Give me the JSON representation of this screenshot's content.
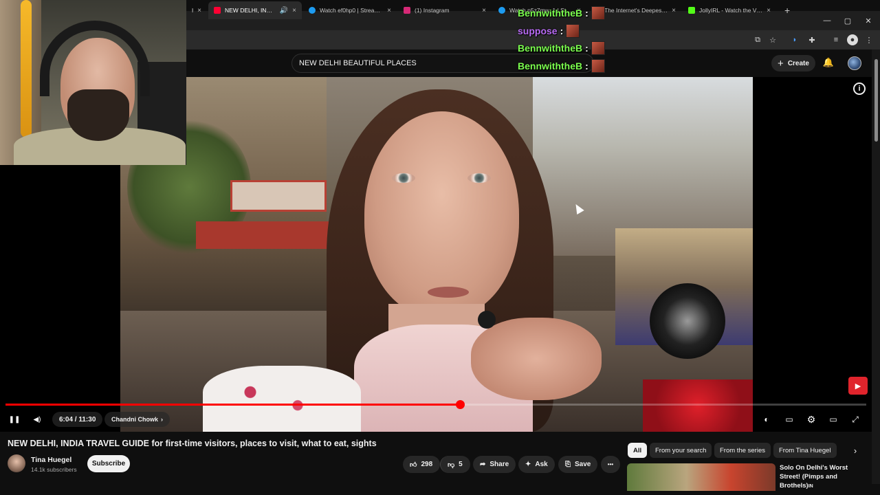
{
  "browser": {
    "tabs": [
      {
        "label": "NEW DELHI, INDIA TRAVEL",
        "favicon_color": "#ff0033",
        "active": true
      },
      {
        "label": "Watch ef0hp0 | Streamable",
        "favicon_color": "#1d9bf0",
        "active": false
      },
      {
        "label": "(1) Instagram",
        "favicon_color": "#d62976",
        "active": false
      },
      {
        "label": "Watch p5z7mw_1 | Streamable",
        "favicon_color": "#1d9bf0",
        "active": false
      },
      {
        "label": "The Internet's Deepest Rabbit Hole",
        "favicon_color": "#ff0033",
        "active": false
      },
      {
        "label": "JollyIRL - Watch the VOD",
        "favicon_color": "#53fc18",
        "active": false
      }
    ],
    "new_tab": "+",
    "close": "×",
    "window_controls": {
      "minimize": "—",
      "maximize": "▢",
      "close": "✕"
    }
  },
  "youtube": {
    "search_value": "NEW DELHI BEAUTIFUL PLACES",
    "create_label": "Create",
    "create_icon": "+",
    "bell_icon": "🔔"
  },
  "chat_overlay": [
    {
      "user": "BennwiththeB",
      "color": "#7cff4f",
      "sep": ":"
    },
    {
      "user": "suppose",
      "color": "#b96cf5",
      "sep": ":"
    },
    {
      "user": "BennwiththeB",
      "color": "#7cff4f",
      "sep": ":"
    },
    {
      "user": "BennwiththeB",
      "color": "#7cff4f",
      "sep": ":"
    }
  ],
  "player": {
    "current_time": "6:04",
    "duration": "11:30",
    "time_display": "6:04 / 11:30",
    "progress_fraction": 0.528,
    "chapter": "Chandni Chowk",
    "chapter_chevron": "›",
    "play_icon": "❚❚",
    "volume_icon": "◀)",
    "info_icon": "i",
    "accent": "#ff0000",
    "right_controls": [
      {
        "name": "autoplay-toggle",
        "glyph": "◐"
      },
      {
        "name": "captions-icon",
        "glyph": "▭"
      },
      {
        "name": "settings-icon",
        "glyph": "⚙"
      },
      {
        "name": "theater-icon",
        "glyph": "▭"
      },
      {
        "name": "fullscreen-icon",
        "glyph": "⤢"
      }
    ]
  },
  "video_info": {
    "title": "NEW DELHI, INDIA TRAVEL GUIDE for first-time visitors, places to visit, what to eat, sights",
    "channel": "Tina Huegel",
    "subscribers": "14.1k subscribers",
    "subscribe_label": "Subscribe",
    "likes": "298",
    "dislikes": "5",
    "share_label": "Share",
    "ask_label": "Ask",
    "save_label": "Save",
    "more_icon": "•••"
  },
  "chips": [
    "All",
    "From your search",
    "From the series",
    "From Tina Huegel"
  ],
  "recommendation": {
    "title": "Solo On Delhi's Worst Street! (Pimps and Brothels)",
    "suffix": "IN"
  }
}
